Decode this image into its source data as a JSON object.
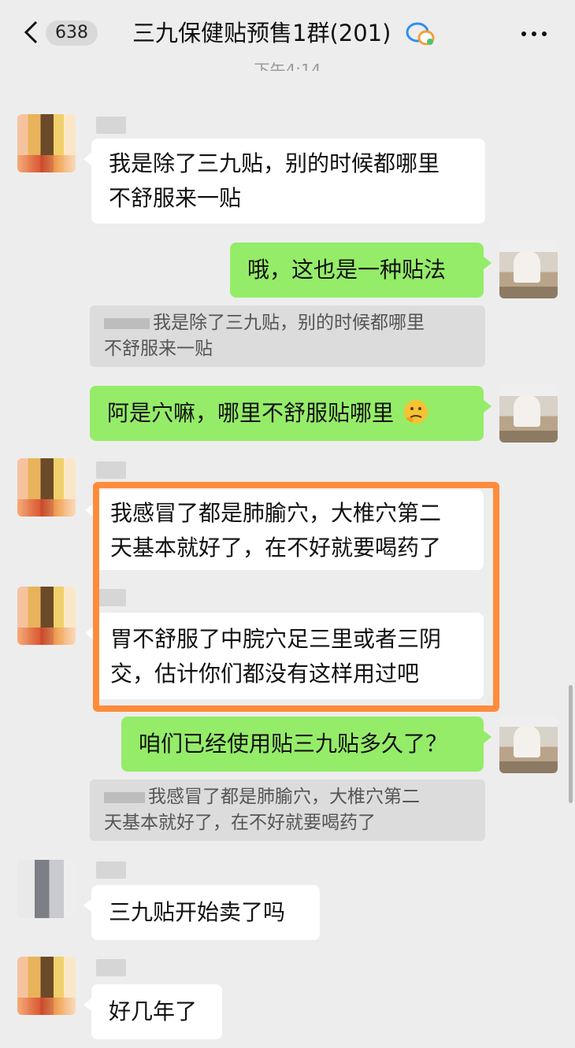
{
  "header": {
    "back_icon": "chevron-left-icon",
    "unread_count": "638",
    "title": "三九保健贴预售1群(201)",
    "group_icon": "chat-bubbles-icon",
    "more_icon": "more-dots-icon"
  },
  "timestamp": "下午4:14",
  "messages": [
    {
      "side": "left",
      "text_lines": [
        "我是除了三九贴，别的时候都哪里",
        "不舒服来一贴"
      ]
    },
    {
      "side": "right",
      "text": "哦，这也是一种贴法"
    },
    {
      "side": "quote",
      "text_lines": [
        "我是除了三九贴，别的时候都哪里",
        "不舒服来一贴"
      ]
    },
    {
      "side": "right",
      "text": "阿是穴嘛，哪里不舒服贴哪里",
      "emoji": "thinking-face-icon"
    },
    {
      "side": "left",
      "text_lines": [
        "我感冒了都是肺腧穴，大椎穴第二",
        "天基本就好了，在不好就要喝药了"
      ]
    },
    {
      "side": "left",
      "text_lines": [
        "胃不舒服了中脘穴足三里或者三阴",
        "交，估计你们都没有这样用过吧"
      ]
    },
    {
      "side": "right",
      "text": "咱们已经使用贴三九贴多久了？"
    },
    {
      "side": "quote",
      "text_lines": [
        "我感冒了都是肺腧穴，大椎穴第二",
        "天基本就好了，在不好就要喝药了"
      ]
    },
    {
      "side": "left",
      "text": "三九贴开始卖了吗"
    },
    {
      "side": "left",
      "text": "好几年了"
    }
  ],
  "colors": {
    "background": "#ededed",
    "my_bubble": "#95ec69",
    "other_bubble": "#ffffff",
    "highlight_border": "#ff8c3a"
  }
}
